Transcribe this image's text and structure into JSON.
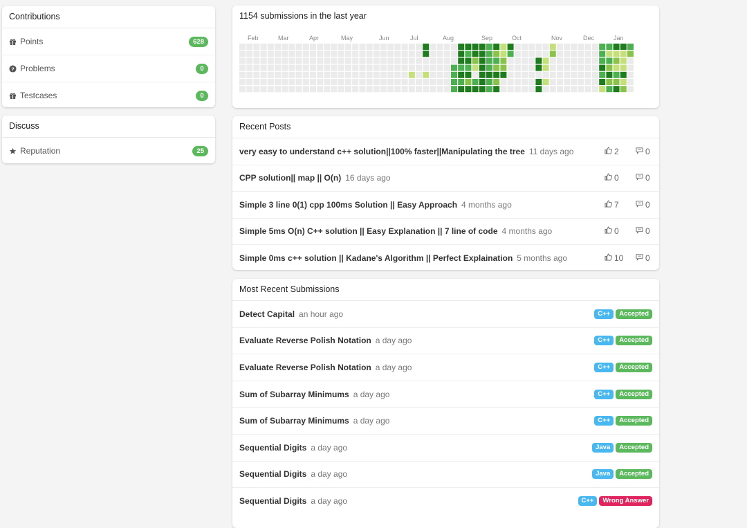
{
  "contributions": {
    "title": "Contributions",
    "items": [
      {
        "icon": "gift-icon",
        "label": "Points",
        "value": "628"
      },
      {
        "icon": "question-circle-icon",
        "label": "Problems",
        "value": "0"
      },
      {
        "icon": "gift-icon",
        "label": "Testcases",
        "value": "0"
      }
    ]
  },
  "discuss": {
    "title": "Discuss",
    "items": [
      {
        "icon": "star-icon",
        "label": "Reputation",
        "value": "25"
      }
    ]
  },
  "heatmap": {
    "title": "1154 submissions in the last year",
    "months": [
      "Feb",
      "Mar",
      "Apr",
      "May",
      "Jun",
      "Jul",
      "Aug",
      "Sep",
      "Oct",
      "Nov",
      "Dec",
      "Jan"
    ],
    "colors": [
      "#ebebeb",
      "#c5e07a",
      "#8bc34a",
      "#4caf50",
      "#1e7b1e"
    ],
    "levels": [
      "00000000000000000000000000000000000000000000000000000000000000000000000000000000000000000000000000000000000000000000000000000000000000000000000000000000000000000000000000000000000000000000000000000000000000000000000000000000000000000000000000000000000000000000000000000000000000000000000000000000000000000000000000000000000000000000000000000000000000000000000000000",
      ""
    ],
    "grid": [
      "00000000000000000000000000000000000000000000000000000000000000000000000000000000",
      "00000000000000000000000000000000000000000000000000000000000000000000000000000000",
      "00000000000000000000000000000000000000000000000000000000000000000000000000000000",
      "00000000000000000000000000000000000000000000000000000000000000000000000000000000",
      "00000000000000000000000000000000000000000000000000000000000000000000000000000000",
      "00000000000000000000000000000000000000000000000000000000000000000000000000000000",
      "00000000000000000000000000000000000000000000000000000000000000000000000000000000"
    ],
    "weeks": [
      "0000000",
      "0000000",
      "0000000",
      "0000000",
      "0000000",
      "0000000",
      "0000000",
      "0000000",
      "0000000",
      "0000000",
      "0000000",
      "0000000",
      "0000000",
      "0000000",
      "0000000",
      "0000000",
      "0000000",
      "0000000",
      "0000000",
      "0000000",
      "0000000",
      "0000000",
      "0000000",
      "0000000",
      "0000100",
      "0000000",
      "4400100",
      "0000000",
      "0000000",
      "0000000",
      "0003333",
      "4443434",
      "4343424",
      "4421034",
      "4444444",
      "3333433",
      "4232424",
      "1122400",
      "4300000",
      "0000000",
      "0000000",
      "0000000",
      "0044044",
      "0011010",
      "1200000",
      "0000000",
      "0000000",
      "0000000",
      "0000000",
      "0000000",
      "0000000",
      "3334341",
      "3132423",
      "4121324",
      "4111412",
      "3200000"
    ]
  },
  "recent_posts": {
    "title": "Recent Posts",
    "items": [
      {
        "title": "very easy to understand c++ solution||100% faster||Manipulating the tree",
        "time": "11 days ago",
        "votes": "2",
        "comments": "0"
      },
      {
        "title": "CPP solution|| map || O(n)",
        "time": "16 days ago",
        "votes": "0",
        "comments": "0"
      },
      {
        "title": "Simple 3 line 0(1) cpp 100ms Solution || Easy Approach",
        "time": "4 months ago",
        "votes": "7",
        "comments": "0"
      },
      {
        "title": "Simple 5ms O(n) C++ solution || Easy Explanation || 7 line of code",
        "time": "4 months ago",
        "votes": "0",
        "comments": "0"
      },
      {
        "title": "Simple 0ms c++ solution || Kadane's Algorithm || Perfect Explaination",
        "time": "5 months ago",
        "votes": "10",
        "comments": "0"
      }
    ]
  },
  "submissions": {
    "title": "Most Recent Submissions",
    "items": [
      {
        "title": "Detect Capital",
        "time": "an hour ago",
        "lang": "C++",
        "status": "Accepted",
        "ok": true
      },
      {
        "title": "Evaluate Reverse Polish Notation",
        "time": "a day ago",
        "lang": "C++",
        "status": "Accepted",
        "ok": true
      },
      {
        "title": "Evaluate Reverse Polish Notation",
        "time": "a day ago",
        "lang": "C++",
        "status": "Accepted",
        "ok": true
      },
      {
        "title": "Sum of Subarray Minimums",
        "time": "a day ago",
        "lang": "C++",
        "status": "Accepted",
        "ok": true
      },
      {
        "title": "Sum of Subarray Minimums",
        "time": "a day ago",
        "lang": "C++",
        "status": "Accepted",
        "ok": true
      },
      {
        "title": "Sequential Digits",
        "time": "a day ago",
        "lang": "Java",
        "status": "Accepted",
        "ok": true
      },
      {
        "title": "Sequential Digits",
        "time": "a day ago",
        "lang": "Java",
        "status": "Accepted",
        "ok": true
      },
      {
        "title": "Sequential Digits",
        "time": "a day ago",
        "lang": "C++",
        "status": "Wrong Answer",
        "ok": false
      }
    ]
  }
}
